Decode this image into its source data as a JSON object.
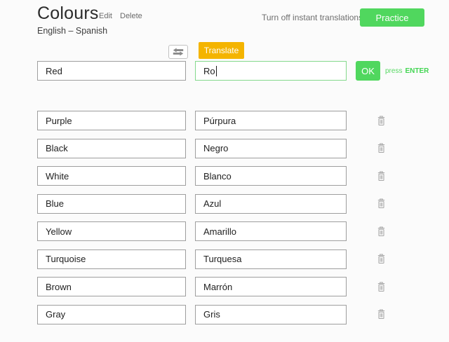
{
  "header": {
    "title": "Colours",
    "edit_label": "Edit",
    "delete_label": "Delete",
    "language_pair": "English – Spanish",
    "instant_translations_label": "Turn off instant translations",
    "practice_label": "Practice"
  },
  "translate": {
    "translate_label": "Translate",
    "source_value": "Red",
    "target_value": "Ro",
    "ok_label": "OK",
    "press_label": "press",
    "enter_label": "ENTER"
  },
  "rows": [
    {
      "term": "Purple",
      "translation": "Púrpura"
    },
    {
      "term": "Black",
      "translation": "Negro"
    },
    {
      "term": "White",
      "translation": "Blanco"
    },
    {
      "term": "Blue",
      "translation": "Azul"
    },
    {
      "term": "Yellow",
      "translation": "Amarillo"
    },
    {
      "term": "Turquoise",
      "translation": "Turquesa"
    },
    {
      "term": "Brown",
      "translation": "Marrón"
    },
    {
      "term": "Gray",
      "translation": "Gris"
    }
  ],
  "icons": {
    "swap": "swap-horizontal-icon",
    "delete_row": "trash-icon"
  },
  "colors": {
    "green": "#50d75e",
    "green_light_border": "#84d98c",
    "amber": "#f4b400",
    "input_border": "#9e9e9e",
    "icon_gray": "#a6a6a6"
  }
}
